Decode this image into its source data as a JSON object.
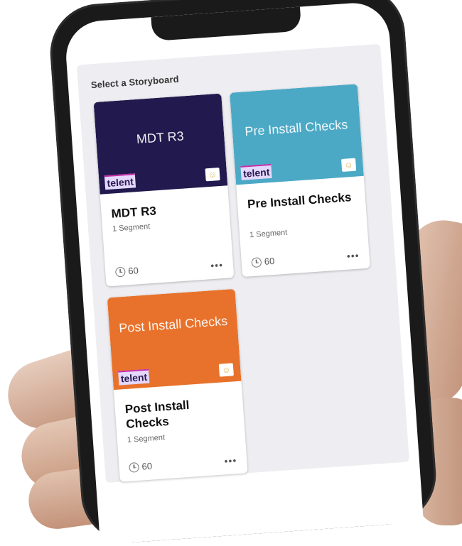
{
  "heading": "Select a Storyboard",
  "cards": [
    {
      "thumb_title": "MDT R3",
      "thumb_color": "#221a4e",
      "logo": "telent",
      "title": "MDT R3",
      "subtitle": "1 Segment",
      "duration": "60",
      "more": "•••"
    },
    {
      "thumb_title": "Pre Install Checks",
      "thumb_color": "#4ba9c6",
      "logo": "telent",
      "title": "Pre Install Checks",
      "subtitle": "1 Segment",
      "duration": "60",
      "more": "•••"
    },
    {
      "thumb_title": "Post Install Checks",
      "thumb_color": "#e8722b",
      "logo": "telent",
      "title": "Post Install Checks",
      "subtitle": "1 Segment",
      "duration": "60",
      "more": "•••"
    }
  ]
}
